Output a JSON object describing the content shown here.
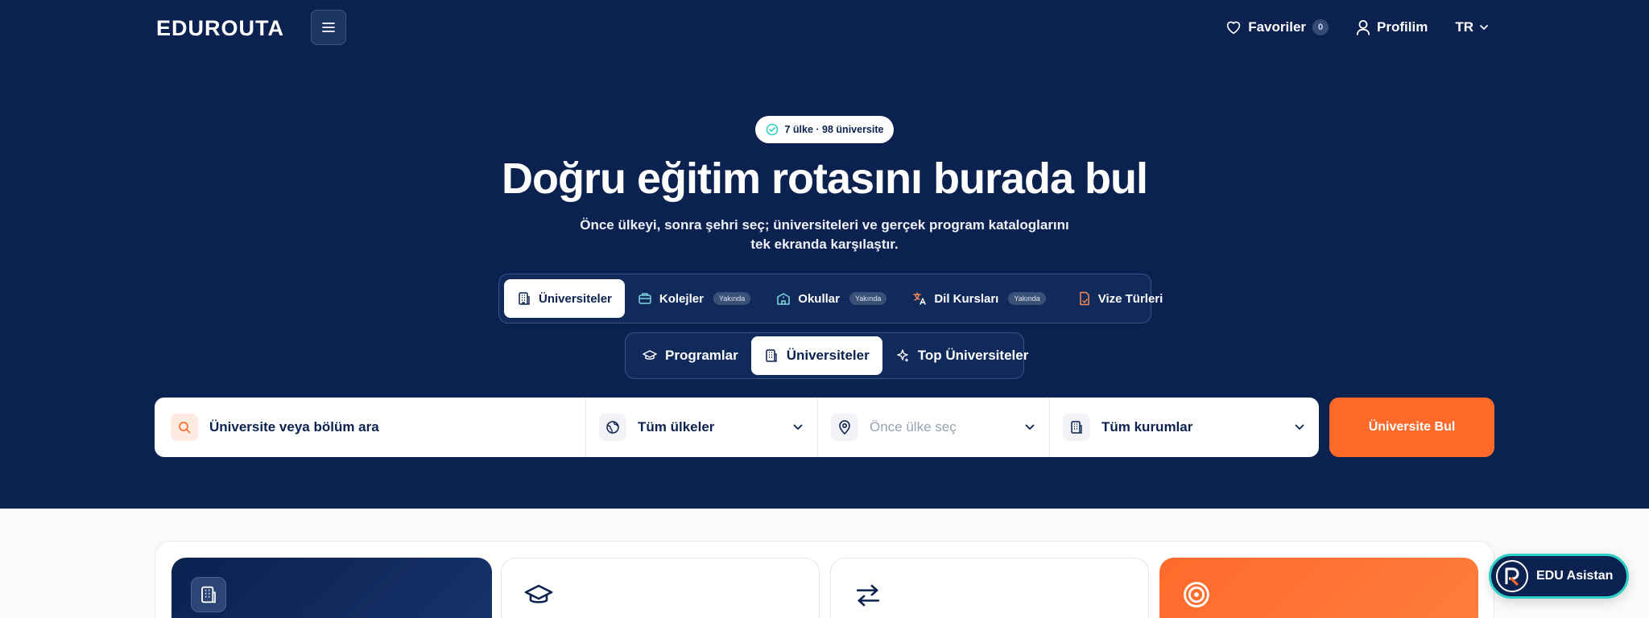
{
  "nav": {
    "logo_text": "EDUROUTA",
    "favorites_label": "Favoriler",
    "favorites_count": "0",
    "profile_label": "Profilim",
    "language": "TR"
  },
  "hero": {
    "stat_pill": "7 ülke · 98 üniversite",
    "headline": "Doğru eğitim rotasını burada bul",
    "subline": "Önce ülkeyi, sonra şehri seç; üniversiteleri ve gerçek program kataloglarını tek ekranda karşılaştır."
  },
  "category_tabs": [
    {
      "label": "Üniversiteler",
      "active": true,
      "badge": ""
    },
    {
      "label": "Kolejler",
      "active": false,
      "badge": "Yakında"
    },
    {
      "label": "Okullar",
      "active": false,
      "badge": "Yakında"
    },
    {
      "label": "Dil Kursları",
      "active": false,
      "badge": "Yakında"
    },
    {
      "label": "Vize Türleri",
      "active": false,
      "badge": ""
    }
  ],
  "sub_tabs": [
    {
      "label": "Programlar",
      "active": false
    },
    {
      "label": "Üniversiteler",
      "active": true
    },
    {
      "label": "Top Üniversiteler",
      "active": false
    }
  ],
  "search": {
    "placeholder": "Üniversite veya bölüm ara",
    "country": "Tüm ülkeler",
    "city": "Önce ülke seç",
    "institution": "Tüm kurumlar",
    "submit_label": "Üniversite Bul"
  },
  "assistant": {
    "label": "EDU Asistan"
  },
  "colors": {
    "navy": "#0b2150",
    "orange": "#ff6a2b",
    "teal": "#2fd0c7"
  }
}
